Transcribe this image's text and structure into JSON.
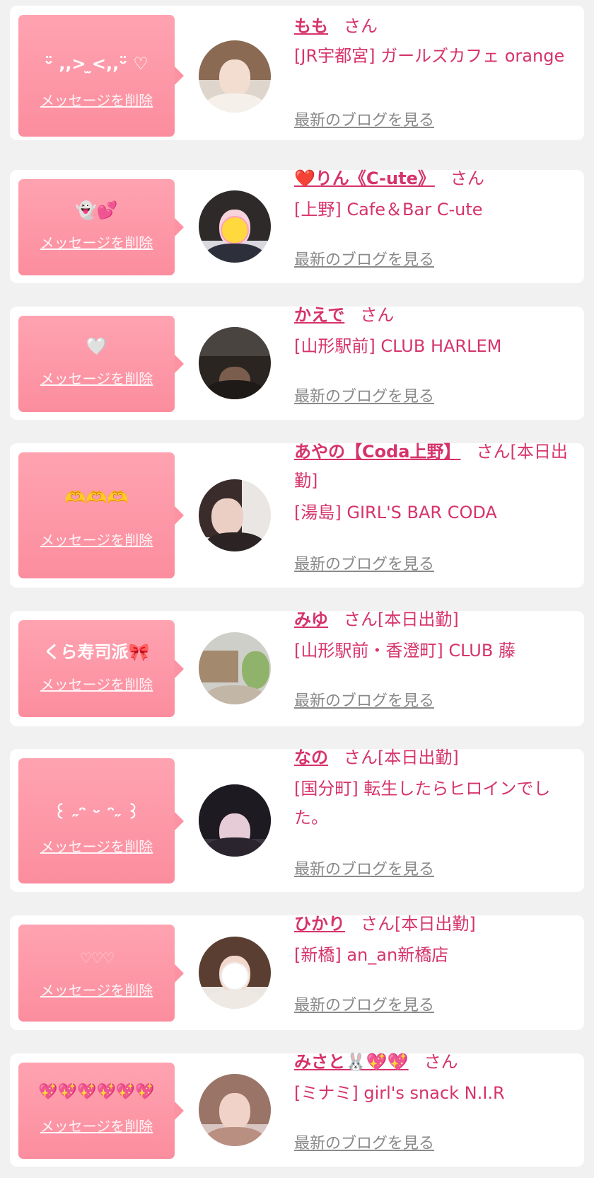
{
  "delete_label": "メッセージを削除",
  "blog_label": "最新のブログを見る",
  "honorific": "さん",
  "colors": {
    "accent": "#d6336c",
    "bubble": "#fb8d9e",
    "card": "#ffffff",
    "page_bg": "#f1f1f1",
    "muted": "#8a8a8a"
  },
  "messages": [
    {
      "message": "ᵕ̈ ,,>  ̫<,,ᵕ̈ ♡",
      "name": "もも",
      "status": "",
      "shop": "[JR宇都宮] ガールズカフェ orange"
    },
    {
      "message": "👻💕",
      "name": "❤️りん《C-ute》",
      "status": "",
      "shop": "[上野] Cafe＆Bar C-ute"
    },
    {
      "message": "🤍",
      "name": "かえで",
      "status": "",
      "shop": "[山形駅前] CLUB HARLEM"
    },
    {
      "message": "🫶🫶🫶",
      "name": "あやの【Coda上野】",
      "status": "[本日出勤]",
      "shop": "[湯島] GIRL'S BAR CODA"
    },
    {
      "message": "くら寿司派🎀",
      "name": "みゆ",
      "status": "[本日出勤]",
      "shop": "[山形駅前・香澄町] CLUB 藤"
    },
    {
      "message": "꒰ ˶ᵔ ᵕ ᵔ˶ ꒱",
      "name": "なの",
      "status": "[本日出勤]",
      "shop": "[国分町] 転生したらヒロインでした。"
    },
    {
      "message": "♡♡♡",
      "name": "ひかり",
      "status": "[本日出勤]",
      "shop": "[新橋] an_an新橋店"
    },
    {
      "message": "💖💖💖💖💖💖",
      "name": "みさと🐰💖💖",
      "status": "",
      "shop": "[ミナミ] girl's snack N.I.R"
    }
  ]
}
